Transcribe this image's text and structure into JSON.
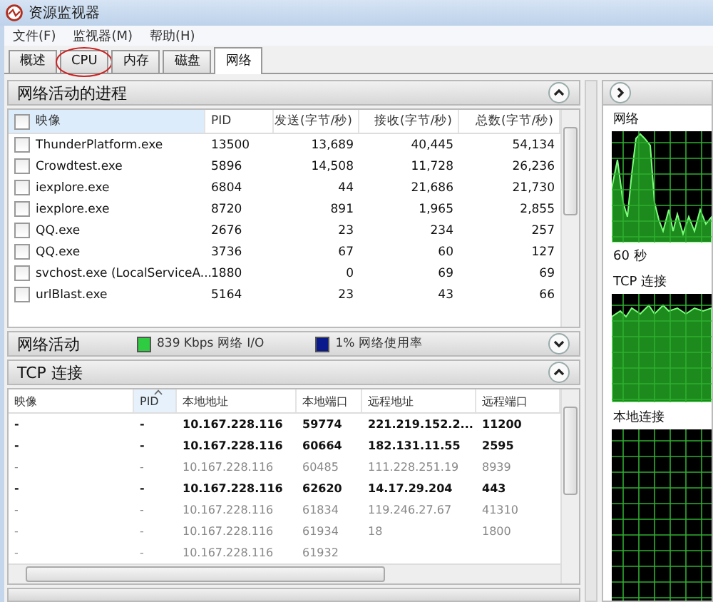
{
  "window": {
    "title": "资源监视器"
  },
  "menu": [
    "文件(F)",
    "监视器(M)",
    "帮助(H)"
  ],
  "tabs": [
    {
      "label": "概述",
      "selected": false,
      "circled": false
    },
    {
      "label": "CPU",
      "selected": false,
      "circled": true
    },
    {
      "label": "内存",
      "selected": false,
      "circled": false
    },
    {
      "label": "磁盘",
      "selected": false,
      "circled": false
    },
    {
      "label": "网络",
      "selected": true,
      "circled": false
    }
  ],
  "processes": {
    "title": "网络活动的进程",
    "expanded": true,
    "all_checked": false,
    "columns": [
      "映像",
      "PID",
      "发送(字节/秒)",
      "接收(字节/秒)",
      "总数(字节/秒)"
    ],
    "rows": [
      {
        "checked": false,
        "cells": [
          "ThunderPlatform.exe",
          "13500",
          "13,689",
          "40,445",
          "54,134"
        ]
      },
      {
        "checked": false,
        "cells": [
          "Crowdtest.exe",
          "5896",
          "14,508",
          "11,728",
          "26,236"
        ]
      },
      {
        "checked": false,
        "cells": [
          "iexplore.exe",
          "6804",
          "44",
          "21,686",
          "21,730"
        ]
      },
      {
        "checked": false,
        "cells": [
          "iexplore.exe",
          "8720",
          "891",
          "1,965",
          "2,855"
        ]
      },
      {
        "checked": false,
        "cells": [
          "QQ.exe",
          "2676",
          "23",
          "234",
          "257"
        ]
      },
      {
        "checked": false,
        "cells": [
          "QQ.exe",
          "3736",
          "67",
          "60",
          "127"
        ]
      },
      {
        "checked": false,
        "cells": [
          "svchost.exe (LocalServiceA...",
          "1880",
          "0",
          "69",
          "69"
        ]
      },
      {
        "checked": false,
        "cells": [
          "urlBlast.exe",
          "5164",
          "23",
          "43",
          "66"
        ]
      }
    ]
  },
  "activity": {
    "title": "网络活动",
    "expanded": false,
    "legend": [
      {
        "label": "839 Kbps 网络 I/O",
        "color": "#2ecc40"
      },
      {
        "label": "1% 网络使用率",
        "color": "#0a1a8c"
      }
    ]
  },
  "tcp": {
    "title": "TCP 连接",
    "expanded": true,
    "columns": [
      {
        "label": "映像",
        "sorted": false
      },
      {
        "label": "PID",
        "sorted": true
      },
      {
        "label": "本地地址",
        "sorted": false
      },
      {
        "label": "本地端口",
        "sorted": false
      },
      {
        "label": "远程地址",
        "sorted": false
      },
      {
        "label": "远程端口",
        "sorted": false
      }
    ],
    "rows": [
      {
        "dimmed": false,
        "cells": [
          "-",
          "-",
          "10.167.228.116",
          "59774",
          "221.219.152.2...",
          "11200"
        ]
      },
      {
        "dimmed": false,
        "cells": [
          "-",
          "-",
          "10.167.228.116",
          "60664",
          "182.131.11.55",
          "2595"
        ]
      },
      {
        "dimmed": true,
        "cells": [
          "-",
          "-",
          "10.167.228.116",
          "60485",
          "111.228.251.19",
          "8939"
        ]
      },
      {
        "dimmed": false,
        "cells": [
          "-",
          "-",
          "10.167.228.116",
          "62620",
          "14.17.29.204",
          "443"
        ]
      },
      {
        "dimmed": true,
        "cells": [
          "-",
          "-",
          "10.167.228.116",
          "61834",
          "119.246.27.67",
          "41310"
        ]
      },
      {
        "dimmed": true,
        "cells": [
          "-",
          "-",
          "10.167.228.116",
          "61934",
          "18",
          "1800"
        ]
      },
      {
        "dimmed": true,
        "cells": [
          "-",
          "-",
          "10.167.228.116",
          "61932"
        ]
      }
    ]
  },
  "side": {
    "graphs": [
      {
        "label": "网络",
        "kind": "peaks"
      },
      {
        "label": "TCP 连接",
        "kind": "plateau"
      },
      {
        "label": "本地连接",
        "kind": "flat"
      }
    ],
    "time_label": "60 秒"
  }
}
